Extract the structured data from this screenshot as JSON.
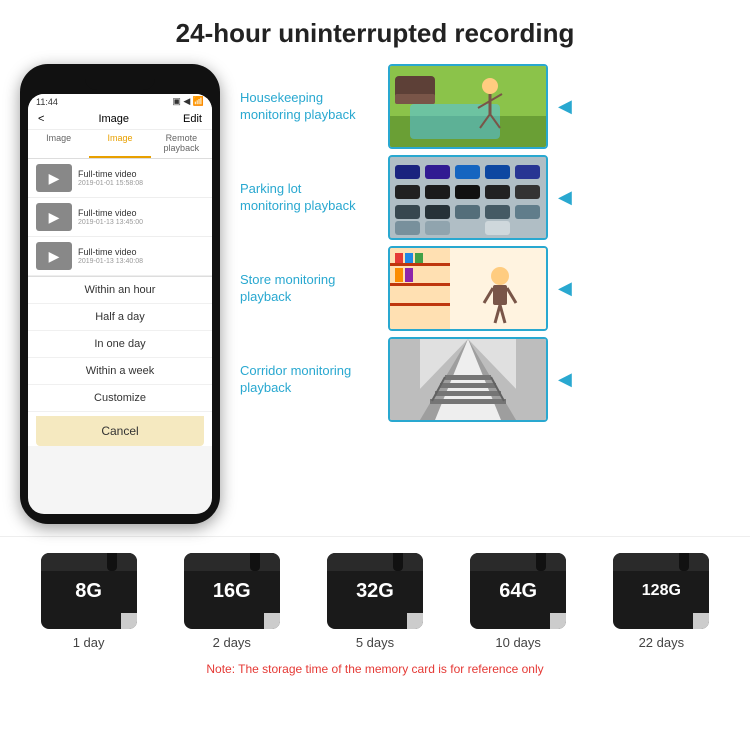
{
  "header": {
    "title": "24-hour uninterrupted recording"
  },
  "phone": {
    "status_bar": {
      "time": "11:44",
      "icons": "▣ ◀"
    },
    "nav": {
      "back": "<",
      "title": "Image",
      "edit": "Edit"
    },
    "tabs": [
      {
        "label": "Image",
        "active": false
      },
      {
        "label": "Image",
        "active": true
      },
      {
        "label": "Remote playback",
        "active": false
      }
    ],
    "list_items": [
      {
        "title": "Full-time video",
        "date": "2019-01-01 15:58:08"
      },
      {
        "title": "Full-time video",
        "date": "2019-01-13 13:45:00"
      },
      {
        "title": "Full-time video",
        "date": "2019-01-13 13:40:08"
      }
    ],
    "dropdown": {
      "items": [
        "Within an hour",
        "Half a day",
        "In one day",
        "Within a week",
        "Customize"
      ],
      "cancel": "Cancel"
    }
  },
  "monitoring": [
    {
      "label": "Housekeeping\nmonitoring playback",
      "photo_type": "housekeeping",
      "emoji": "🧒"
    },
    {
      "label": "Parking lot\nmonitoring playback",
      "photo_type": "parking",
      "emoji": "🚗"
    },
    {
      "label": "Store monitoring\nplayback",
      "photo_type": "store",
      "emoji": "🏪"
    },
    {
      "label": "Corridor monitoring\nplayback",
      "photo_type": "corridor",
      "emoji": "🏗️"
    }
  ],
  "sd_cards": [
    {
      "size": "8G",
      "days": "1 day"
    },
    {
      "size": "16G",
      "days": "2 days"
    },
    {
      "size": "32G",
      "days": "5 days"
    },
    {
      "size": "64G",
      "days": "10 days"
    },
    {
      "size": "128G",
      "days": "22 days"
    }
  ],
  "note": "Note: The storage time of the memory card is for reference only",
  "colors": {
    "accent": "#29a8d0",
    "note_color": "#e53935"
  }
}
